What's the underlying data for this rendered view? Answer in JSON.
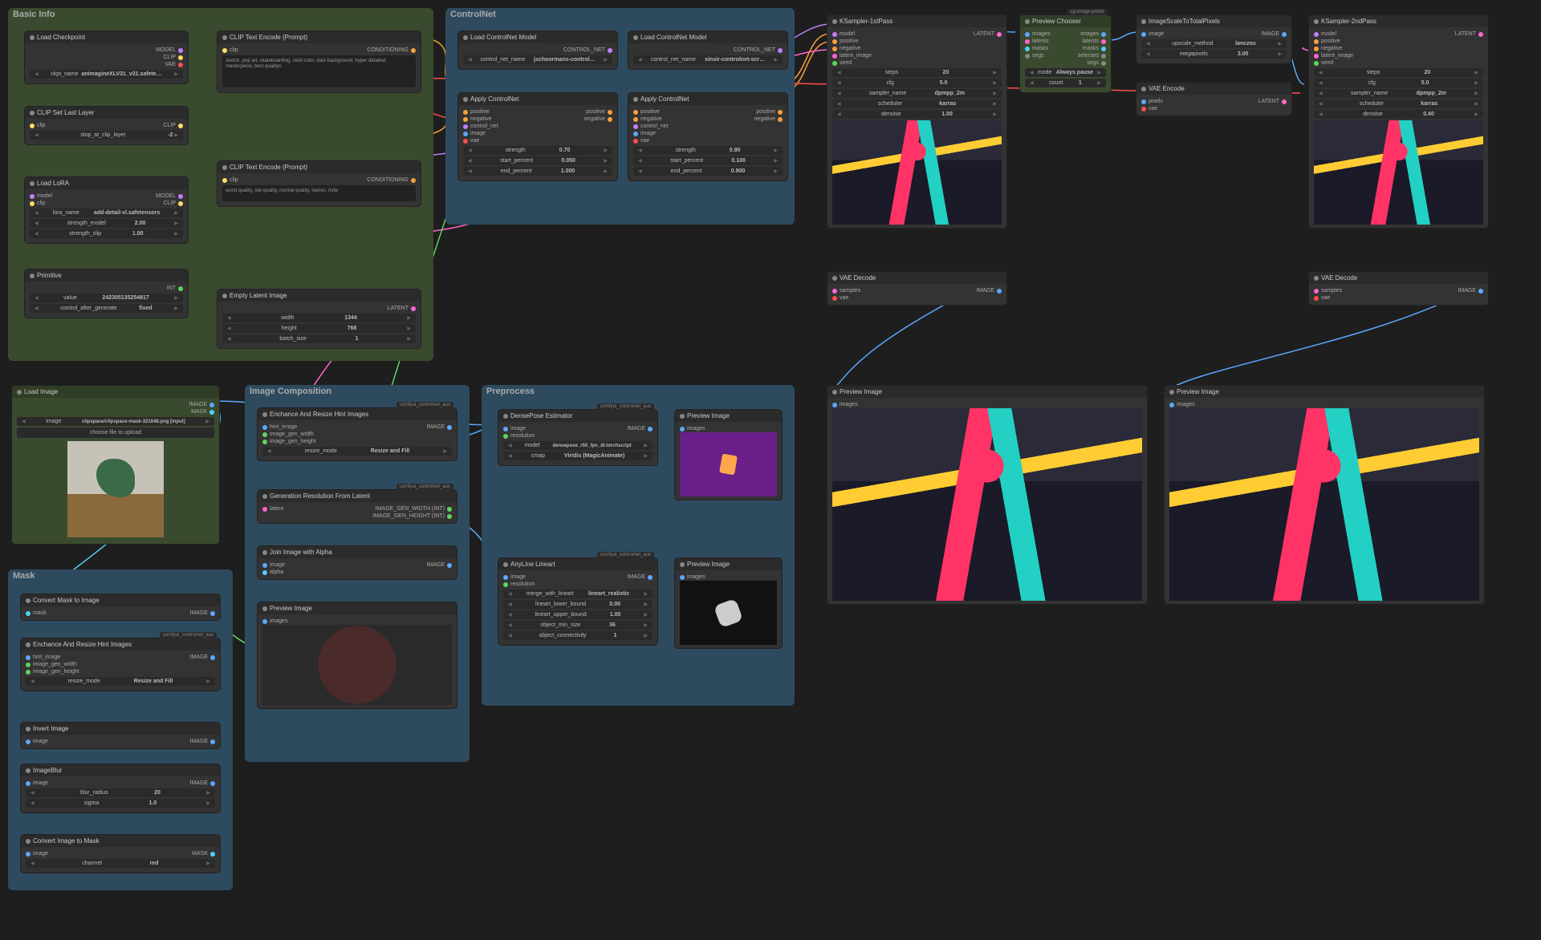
{
  "groups": {
    "basic": {
      "title": "Basic Info"
    },
    "controlnet": {
      "title": "ControlNet"
    },
    "comp": {
      "title": "Image Composition"
    },
    "pre": {
      "title": "Preprocess"
    },
    "mask": {
      "title": "Mask"
    }
  },
  "badges": {
    "cg": "cg-image-picker",
    "aux": "comfyui_controlnet_aux"
  },
  "lbl": {
    "model": "MODEL",
    "clip": "CLIP",
    "vae": "VAE",
    "conditioning": "CONDITIONING",
    "latent": "LATENT",
    "image": "IMAGE",
    "mask": "MASK",
    "int": "INT",
    "control_net": "CONTROL_NET",
    "clip_l": "clip",
    "model_l": "model",
    "positive": "positive",
    "negative": "negative",
    "control_net_l": "control_net",
    "image_l": "image",
    "vae_l": "vae",
    "latent_image": "latent_image",
    "seed": "seed",
    "samples": "samples",
    "images": "images",
    "latents": "latents",
    "masks": "masks",
    "segs": "segs",
    "selected": "selected",
    "pixels": "pixels",
    "hint_image": "hint_image",
    "image_gen_width": "image_gen_width",
    "image_gen_height": "image_gen_height",
    "latent_l": "latent",
    "alpha": "alpha",
    "mask_l": "mask",
    "resolution": "resolution",
    "igw": "IMAGE_GEN_WIDTH (INT)",
    "igh": "IMAGE_GEN_HEIGHT (INT)"
  },
  "nodes": {
    "load_ckpt": {
      "title": "Load Checkpoint",
      "ckpt_name_k": "ckpt_name",
      "ckpt_name_v": "animagineXLV31_v31.safete…"
    },
    "clip_set": {
      "title": "CLIP Set Last Layer",
      "stop_k": "stop_at_clip_layer",
      "stop_v": "-2"
    },
    "load_lora": {
      "title": "Load LoRA",
      "lora_k": "lora_name",
      "lora_v": "add-detail-xl.safetensors",
      "sm_k": "strength_model",
      "sm_v": "2.00",
      "sc_k": "strength_clip",
      "sc_v": "1.00"
    },
    "primitive": {
      "title": "Primitive",
      "val_k": "value",
      "val_v": "242305135254817",
      "cag_k": "control_after_generate",
      "cag_v": "fixed"
    },
    "clip_pos": {
      "title": "CLIP Text Encode (Prompt)",
      "text": "sketch, pop art, skateboarding, vivid color, dark background, hyper detailed, masterpiece, best qualityn"
    },
    "clip_neg": {
      "title": "CLIP Text Encode (Prompt)",
      "text": "worst quality, low quality, normal quality, lowres, nsfw"
    },
    "empty_latent": {
      "title": "Empty Latent Image",
      "w_k": "width",
      "w_v": "1344",
      "h_k": "height",
      "h_v": "768",
      "b_k": "batch_size",
      "b_v": "1"
    },
    "load_cn1": {
      "title": "Load ControlNet Model",
      "k": "control_net_name",
      "v": "jschoormans-control…"
    },
    "load_cn2": {
      "title": "Load ControlNet Model",
      "k": "control_net_name",
      "v": "xinsir-controlnet-scr…"
    },
    "apply_cn": {
      "title": "Apply ControlNet",
      "str_k": "strength",
      "str1": "0.70",
      "str2": "0.90",
      "sp_k": "start_percent",
      "sp1": "0.050",
      "sp2": "0.100",
      "ep_k": "end_percent",
      "ep1": "1.000",
      "ep2": "0.900"
    },
    "ksampler1": {
      "title": "KSampler-1stPass",
      "steps_k": "steps",
      "steps_v": "20",
      "cfg_k": "cfg",
      "cfg_v": "5.0",
      "samp_k": "sampler_name",
      "samp_v": "dpmpp_2m",
      "sch_k": "scheduler",
      "sch_v": "karras",
      "den_k": "denoise",
      "den_v": "1.00"
    },
    "ksampler2": {
      "title": "KSampler-2ndPass",
      "steps_v": "20",
      "cfg_v": "5.0",
      "samp_v": "dpmpp_2m",
      "sch_v": "karras",
      "den_v": "0.40"
    },
    "preview_chooser": {
      "title": "Preview Chooser",
      "mode_k": "mode",
      "mode_v": "Always pause",
      "count_k": "count",
      "count_v": "1"
    },
    "imgscale": {
      "title": "ImageScaleToTotalPixels",
      "up_k": "upscale_method",
      "up_v": "lanczos",
      "mp_k": "megapixels",
      "mp_v": "3.00"
    },
    "vae_enc": {
      "title": "VAE Encode"
    },
    "vae_dec": {
      "title": "VAE Decode"
    },
    "load_img": {
      "title": "Load Image",
      "img_k": "image",
      "img_v": "clipspace/clipspace-mask-321648.png [input]",
      "choose": "choose file to upload"
    },
    "enhance": {
      "title": "Enchance And Resize Hint Images",
      "rm_k": "resize_mode",
      "rm_v": "Resize and Fill"
    },
    "gen_res": {
      "title": "Generation Resolution From Latent"
    },
    "join_alpha": {
      "title": "Join Image with Alpha"
    },
    "preview": {
      "title": "Preview Image"
    },
    "densepose": {
      "title": "DensePose Estimator",
      "model_k": "model",
      "model_v": "densepose_r50_fpn_dl.torchscript",
      "cmap_k": "cmap",
      "cmap_v": "Viridis (MagicAnimate)"
    },
    "anyline": {
      "title": "AnyLine Lineart",
      "mwl_k": "merge_with_lineart",
      "mwl_v": "lineart_realistic",
      "llb_k": "lineart_lower_bound",
      "llb_v": "0.00",
      "lub_k": "lineart_upper_bound",
      "lub_v": "1.00",
      "oms_k": "object_min_size",
      "oms_v": "36",
      "oc_k": "object_connectivity",
      "oc_v": "1"
    },
    "conv_m2i": {
      "title": "Convert Mask to Image"
    },
    "enhance2": {
      "title": "Enchance And Resize Hint Images"
    },
    "invert": {
      "title": "Invert Image"
    },
    "blur": {
      "title": "ImageBlur",
      "br_k": "blur_radius",
      "br_v": "20",
      "sig_k": "sigma",
      "sig_v": "1.0"
    },
    "conv_i2m": {
      "title": "Convert Image to Mask",
      "ch_k": "channel",
      "ch_v": "red"
    }
  }
}
